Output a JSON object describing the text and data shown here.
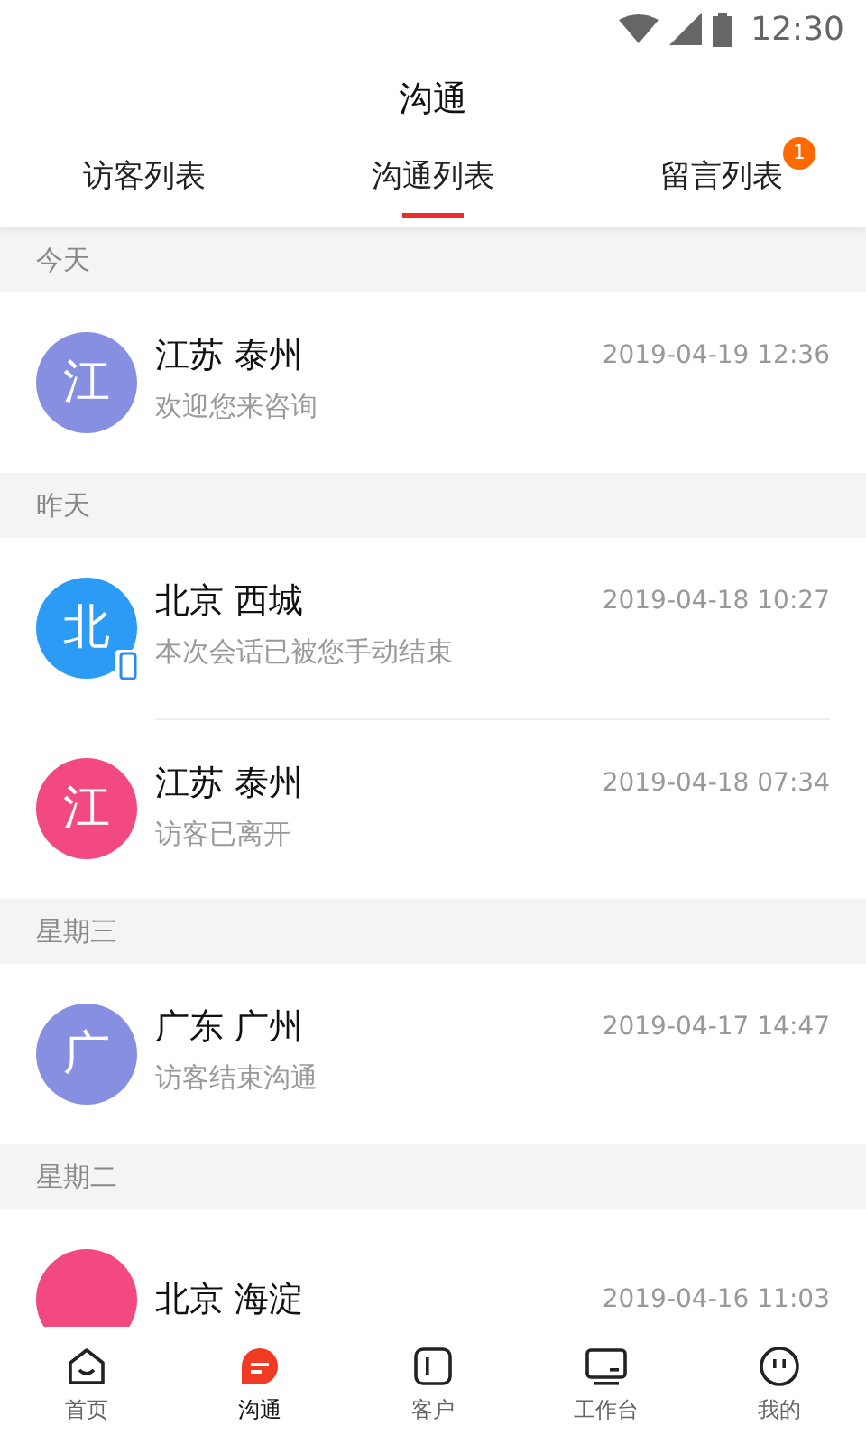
{
  "status_bar": {
    "time": "12:30"
  },
  "title": "沟通",
  "tabs": [
    {
      "label": "访客列表",
      "selected": false
    },
    {
      "label": "沟通列表",
      "selected": true
    },
    {
      "label": "留言列表",
      "selected": false,
      "badge": "1"
    }
  ],
  "sections": [
    {
      "header": "今天",
      "rows": [
        {
          "avatar": "江",
          "color": "#8790e0",
          "mobile": false,
          "name": "江苏 泰州",
          "message": "欢迎您来咨询",
          "time": "2019-04-19 12:36"
        }
      ]
    },
    {
      "header": "昨天",
      "rows": [
        {
          "avatar": "北",
          "color": "#2b9bf6",
          "mobile": true,
          "name": "北京 西城",
          "message": "本次会话已被您手动结束",
          "time": "2019-04-18 10:27"
        },
        {
          "avatar": "江",
          "color": "#f24a80",
          "mobile": false,
          "name": "江苏 泰州",
          "message": "访客已离开",
          "time": "2019-04-18 07:34"
        }
      ]
    },
    {
      "header": "星期三",
      "rows": [
        {
          "avatar": "广",
          "color": "#8790e0",
          "mobile": false,
          "name": "广东 广州",
          "message": "访客结束沟通",
          "time": "2019-04-17 14:47"
        }
      ]
    },
    {
      "header": "星期二",
      "rows": [
        {
          "avatar": "",
          "color": "#f24a80",
          "mobile": false,
          "name": "北京 海淀",
          "time": "2019-04-16 11:03"
        }
      ]
    }
  ],
  "bottom_nav": [
    {
      "kind": "home",
      "label": "首页",
      "selected": false
    },
    {
      "kind": "chat",
      "label": "沟通",
      "selected": true
    },
    {
      "kind": "customer",
      "label": "客户",
      "selected": false
    },
    {
      "kind": "desk",
      "label": "工作台",
      "selected": false
    },
    {
      "kind": "me",
      "label": "我的",
      "selected": false
    }
  ]
}
